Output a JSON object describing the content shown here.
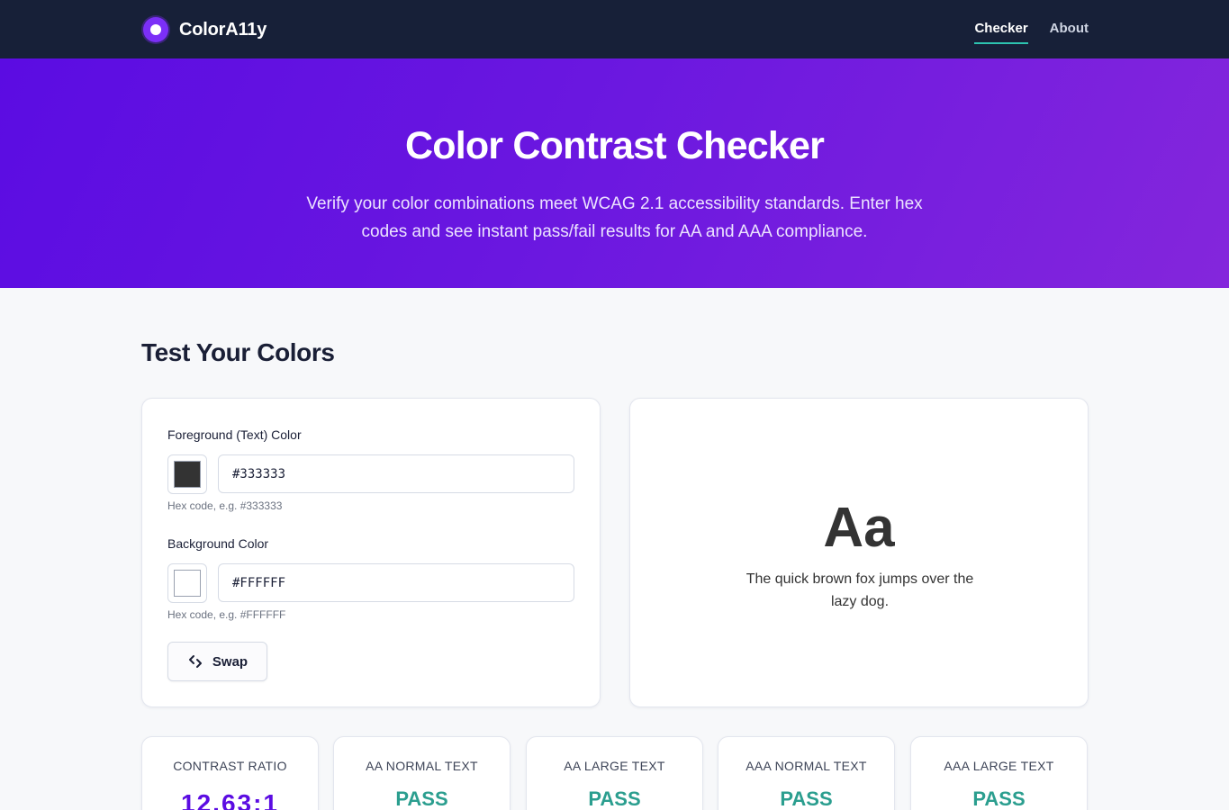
{
  "nav": {
    "brand": "ColorA11y",
    "links": [
      {
        "label": "Checker",
        "active": true
      },
      {
        "label": "About",
        "active": false
      }
    ]
  },
  "hero": {
    "title": "Color Contrast Checker",
    "subtitle": "Verify your color combinations meet WCAG 2.1 accessibility standards. Enter hex codes and see instant pass/fail results for AA and AAA compliance."
  },
  "section": {
    "title": "Test Your Colors"
  },
  "inputs": {
    "foreground": {
      "label": "Foreground (Text) Color",
      "value": "#333333",
      "hint": "Hex code, e.g. #333333",
      "swatch_color": "#333333"
    },
    "background": {
      "label": "Background Color",
      "value": "#FFFFFF",
      "hint": "Hex code, e.g. #FFFFFF",
      "swatch_color": "#FFFFFF"
    },
    "swap_label": "Swap"
  },
  "preview": {
    "sample": "Aa",
    "text": "The quick brown fox jumps over the lazy dog."
  },
  "results": [
    {
      "label": "CONTRAST RATIO",
      "value": "12.63:1"
    },
    {
      "label": "AA NORMAL TEXT",
      "value": "PASS"
    },
    {
      "label": "AA LARGE TEXT",
      "value": "PASS"
    },
    {
      "label": "AAA NORMAL TEXT",
      "value": "PASS"
    },
    {
      "label": "AAA LARGE TEXT",
      "value": "PASS"
    }
  ],
  "colors": {
    "nav_bg": "#172038",
    "accent": "#5b0ce2",
    "pass": "#2b9e8f",
    "active_underline": "#2dc3b0"
  }
}
